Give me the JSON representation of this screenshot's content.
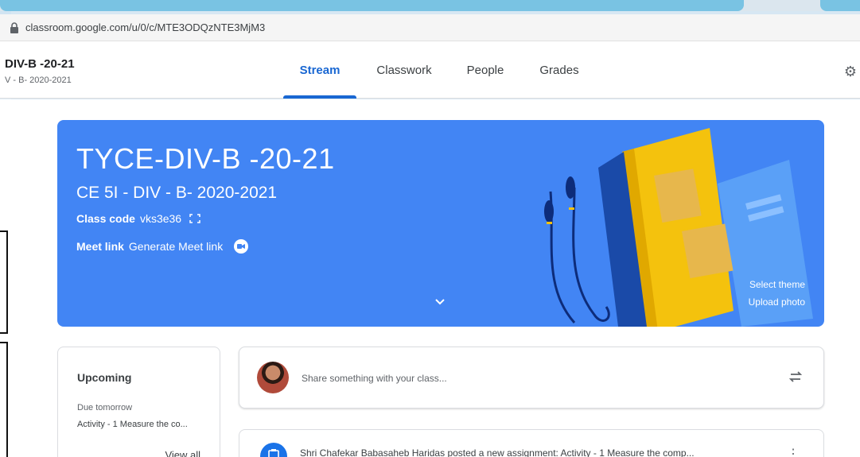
{
  "browser": {
    "url": "classroom.google.com/u/0/c/MTE3ODQzNTE3MjM3"
  },
  "header": {
    "class_title": "DIV-B -20-21",
    "class_sub": "V - B- 2020-2021",
    "tabs": [
      {
        "label": "Stream"
      },
      {
        "label": "Classwork"
      },
      {
        "label": "People"
      },
      {
        "label": "Grades"
      }
    ]
  },
  "banner": {
    "title": "TYCE-DIV-B -20-21",
    "section": "CE 5I - DIV - B- 2020-2021",
    "class_code_label": "Class code",
    "class_code_value": "vks3e36",
    "meet_label": "Meet link",
    "meet_value": "Generate Meet link",
    "select_theme": "Select theme",
    "upload_photo": "Upload photo",
    "color": "#4285f4"
  },
  "upcoming": {
    "title": "Upcoming",
    "due_label": "Due tomorrow",
    "due_item": "Activity - 1 Measure the co...",
    "view_all": "View all"
  },
  "share": {
    "placeholder": "Share something with your class..."
  },
  "post": {
    "text": "Shri Chafekar Babasaheb Haridas posted a new assignment: Activity - 1 Measure the comp..."
  }
}
